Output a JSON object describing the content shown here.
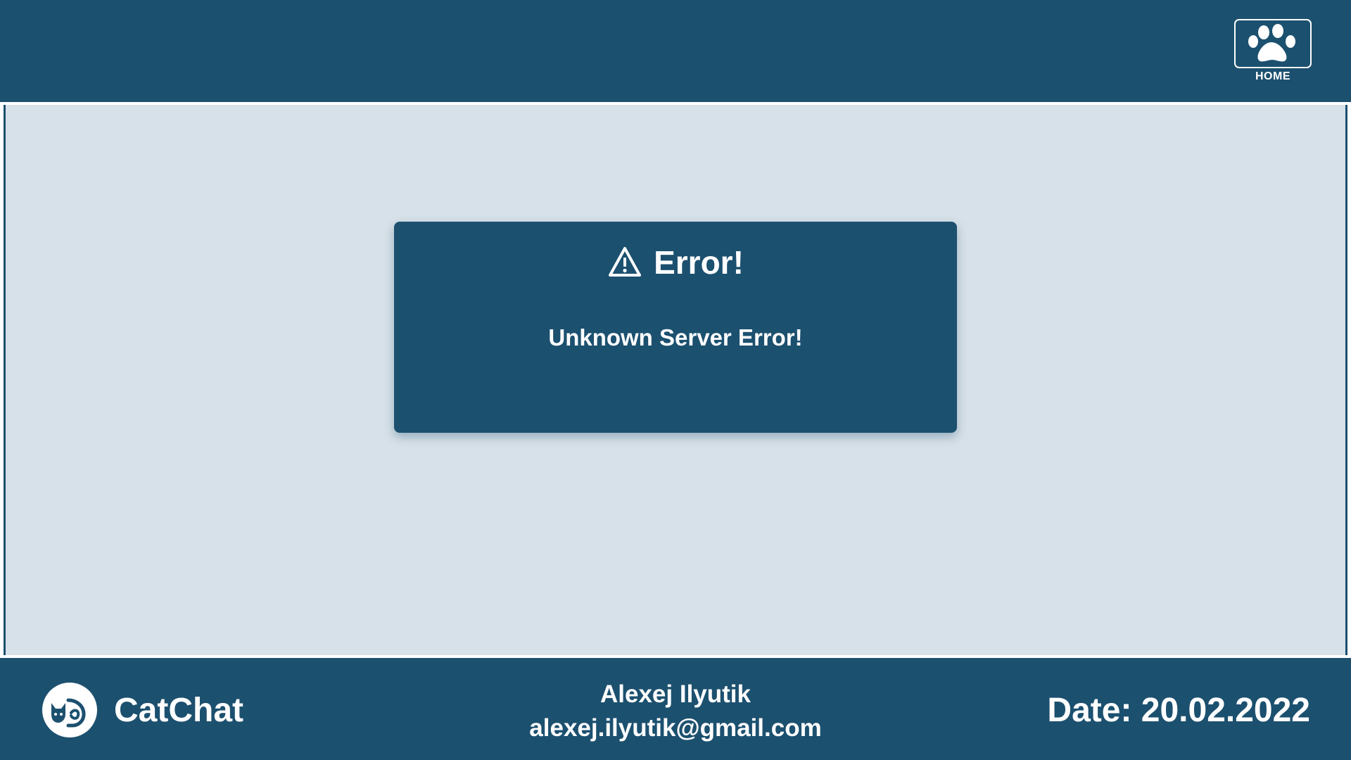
{
  "header": {
    "home_label": "HOME",
    "home_icon": "paw-icon"
  },
  "error": {
    "icon": "warning-triangle-icon",
    "title": "Error!",
    "message": "Unknown Server Error!"
  },
  "footer": {
    "brand_icon": "cat-logo-icon",
    "brand_name": "CatChat",
    "author_name": "Alexej Ilyutik",
    "author_email": "alexej.ilyutik@gmail.com",
    "date_text": "Date: 20.02.2022"
  },
  "colors": {
    "primary": "#1c506f",
    "background": "#d7e1e9",
    "text_on_primary": "#ffffff"
  }
}
